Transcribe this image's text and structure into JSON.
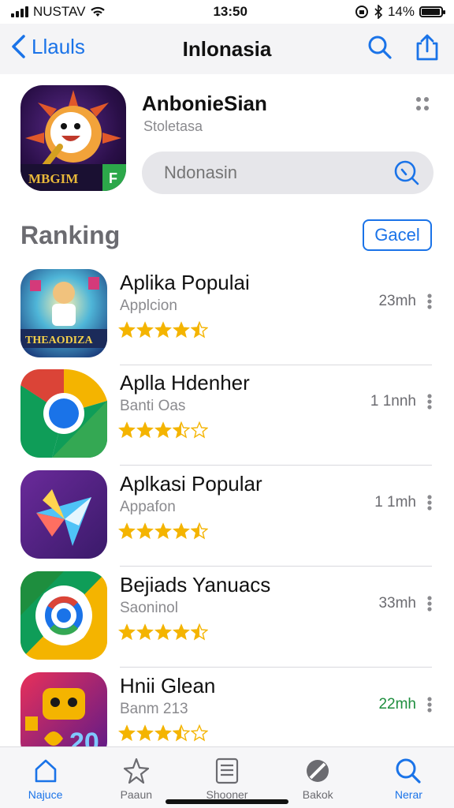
{
  "status_bar": {
    "carrier": "NUSTAV",
    "time": "13:50",
    "battery_text": "14%",
    "battery_level": 0.9
  },
  "nav": {
    "back_label": "Llauls",
    "title": "Inlonasia"
  },
  "featured": {
    "title": "AnbonieSian",
    "subtitle": "Stoletasa",
    "icon_text": "MBGIM",
    "search_placeholder": "Ndonasin"
  },
  "ranking": {
    "title": "Ranking",
    "cancel_label": "Gacel"
  },
  "apps": [
    {
      "name": "Aplika Populai",
      "category": "Applcion",
      "meta": "23mh",
      "rating": 4.5,
      "icon_text": "THEAODIZA"
    },
    {
      "name": "Aplla Hdenher",
      "category": "Banti Oas",
      "meta": "1 1nnh",
      "rating": 3.5,
      "icon_text": ""
    },
    {
      "name": "Aplkasi  Popular",
      "category": "Appafon",
      "meta": "1 1mh",
      "rating": 4.5,
      "icon_text": ""
    },
    {
      "name": "Bejiads Yanuacs",
      "category": "Saoninol",
      "meta": "33mh",
      "rating": 4.5,
      "icon_text": ""
    },
    {
      "name": "Hnii Glean",
      "category": "Banm 213",
      "meta": "22mh",
      "rating": 3.5,
      "icon_text": "20"
    }
  ],
  "tabs": [
    {
      "label": "Najuce",
      "icon": "home-icon",
      "active": true
    },
    {
      "label": "Paaun",
      "icon": "star-outline-icon",
      "active": false
    },
    {
      "label": "Shooner",
      "icon": "list-icon",
      "active": false
    },
    {
      "label": "Bakok",
      "icon": "no-entry-icon",
      "active": false
    },
    {
      "label": "Nerar",
      "icon": "search-icon",
      "active": true
    }
  ],
  "colors": {
    "accent": "#1a73e8",
    "star": "#f4b400",
    "meta_green": "#1e8e3e"
  }
}
